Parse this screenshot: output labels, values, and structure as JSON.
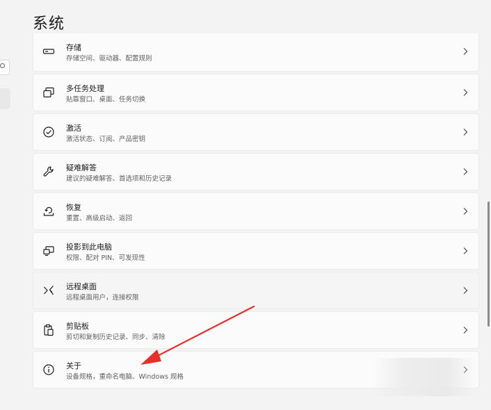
{
  "page": {
    "title": "系统"
  },
  "colors": {
    "background": "#f3f3f3",
    "card": "#fbfbfb",
    "annotation_arrow": "#e8302a"
  },
  "items": [
    {
      "icon": "storage-drive-icon",
      "title": "存储",
      "subtitle": "存储空间、驱动器、配置规则"
    },
    {
      "icon": "multitasking-windows-icon",
      "title": "多任务处理",
      "subtitle": "贴靠窗口、桌面、任务切换"
    },
    {
      "icon": "activation-check-icon",
      "title": "激活",
      "subtitle": "激活状态、订阅、产品密钥"
    },
    {
      "icon": "wrench-icon",
      "title": "疑难解答",
      "subtitle": "建议的疑难解答、首选项和历史记录"
    },
    {
      "icon": "recovery-icon",
      "title": "恢复",
      "subtitle": "重置、高级启动、返回"
    },
    {
      "icon": "projection-icon",
      "title": "投影到此电脑",
      "subtitle": "权限、配对 PIN、可发现性"
    },
    {
      "icon": "remote-desktop-icon",
      "title": "远程桌面",
      "subtitle": "远程桌面用户，连接权限"
    },
    {
      "icon": "clipboard-icon",
      "title": "剪贴板",
      "subtitle": "剪切和复制历史记录、同步、清除"
    },
    {
      "icon": "info-icon",
      "title": "关于",
      "subtitle": "设备规格，重命名电脑、Windows 规格"
    }
  ]
}
